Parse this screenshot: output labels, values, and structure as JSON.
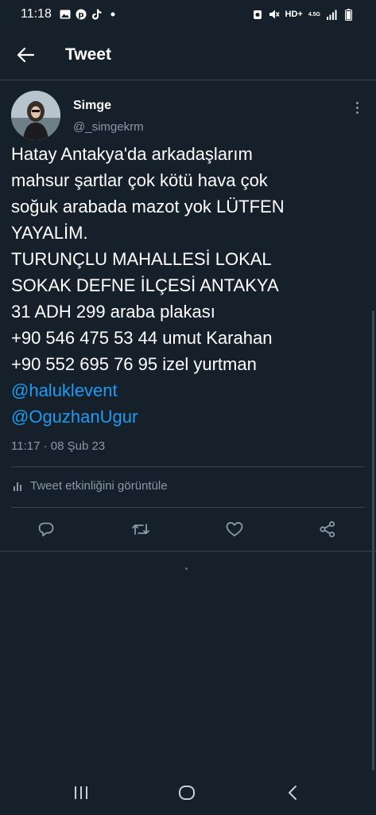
{
  "status_bar": {
    "time": "11:18",
    "network_label": "HD+",
    "network_sub": "4.5G",
    "left_icons": [
      "gallery-icon",
      "pinterest-icon",
      "tiktok-icon",
      "notification-dot-icon"
    ],
    "right_icons": [
      "alarm-icon",
      "mute-icon",
      "signal-icon",
      "battery-icon"
    ]
  },
  "app_bar": {
    "title": "Tweet"
  },
  "tweet": {
    "author_name": "Simge",
    "author_handle": "@_simgekrm",
    "lines": [
      "Hatay Antakya'da arkadaşlarım",
      "mahsur şartlar çok kötü hava çok",
      "soğuk arabada mazot yok LÜTFEN",
      "YAYALİM.",
      "TURUNÇLU MAHALLESİ LOKAL",
      "SOKAK DEFNE İLÇESİ ANTAKYA",
      "31 ADH 299 araba plakası",
      "+90 546 475 53 44 umut Karahan",
      "+90 552 695 76 95 izel yurtman"
    ],
    "mentions": [
      "@haluklevent",
      "@OguzhanUgur"
    ],
    "timestamp": "11:17 · 08 Şub 23",
    "activity_label": "Tweet etkinliğini görüntüle"
  },
  "colors": {
    "background": "#15202b",
    "divider": "#38444d",
    "secondary_text": "#8b98a5",
    "link": "#1d9bf0"
  }
}
